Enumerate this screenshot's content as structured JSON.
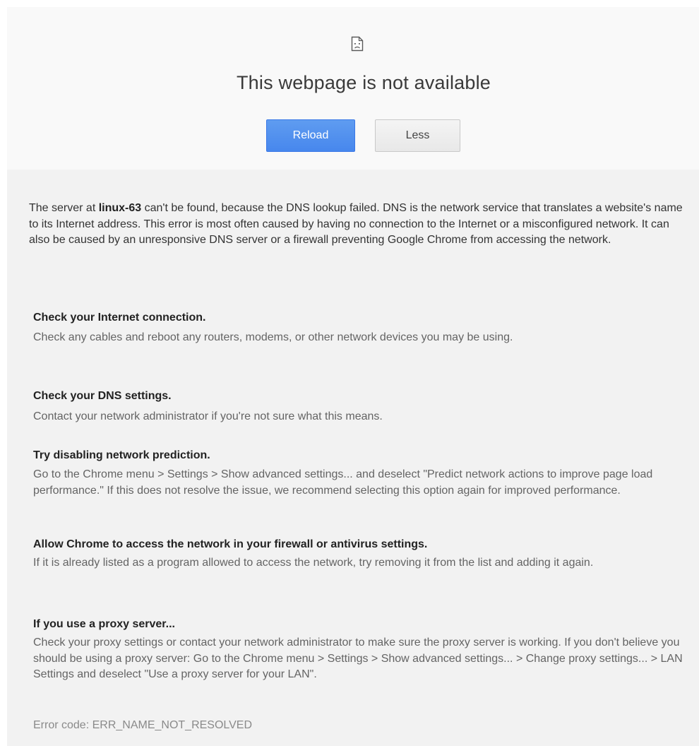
{
  "header": {
    "icon": "sad-page-icon",
    "title": "This webpage is not available",
    "reload_label": "Reload",
    "less_label": "Less"
  },
  "details": {
    "summary_prefix": "The server at ",
    "server_name": "linux-63",
    "summary_suffix": " can't be found, because the DNS lookup failed. DNS is the network service that translates a website's name to its Internet address. This error is most often caused by having no connection to the Internet or a misconfigured network. It can also be caused by an unresponsive DNS server or a firewall preventing Google Chrome from accessing the network.",
    "suggestions": [
      {
        "heading": "Check your Internet connection.",
        "text": "Check any cables and reboot any routers, modems, or other network devices you may be using."
      },
      {
        "heading": "Check your DNS settings.",
        "text": "Contact your network administrator if you're not sure what this means."
      },
      {
        "heading": "Try disabling network prediction.",
        "text": "Go to the Chrome menu > Settings > Show advanced settings... and deselect \"Predict network actions to improve page load performance.\" If this does not resolve the issue, we recommend selecting this option again for improved performance."
      },
      {
        "heading": "Allow Chrome to access the network in your firewall or antivirus settings.",
        "text": "If it is already listed as a program allowed to access the network, try removing it from the list and adding it again."
      },
      {
        "heading": "If you use a proxy server...",
        "text": "Check your proxy settings or contact your network administrator to make sure the proxy server is working. If you don't believe you should be using a proxy server: Go to the Chrome menu > Settings > Show advanced settings... > Change proxy settings... > LAN Settings and deselect \"Use a proxy server for your LAN\"."
      }
    ],
    "error_code": "Error code: ERR_NAME_NOT_RESOLVED"
  },
  "colors": {
    "reload_button": "#4787ed",
    "page_background": "#f2f2f2"
  }
}
